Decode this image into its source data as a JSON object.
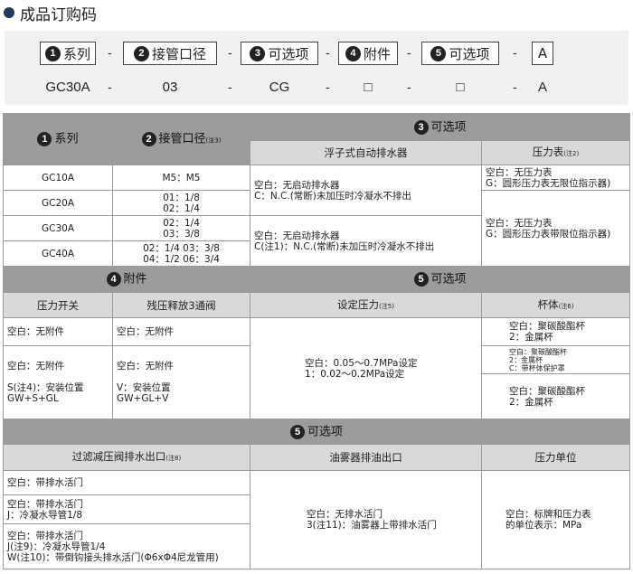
{
  "title": "成品订购码",
  "code": {
    "segments": [
      {
        "num": "1",
        "label": "系列"
      },
      {
        "num": "2",
        "label": "接管口径"
      },
      {
        "num": "3",
        "label": "可选项"
      },
      {
        "num": "4",
        "label": "附件"
      },
      {
        "num": "5",
        "label": "可选项"
      },
      {
        "label": "A"
      }
    ],
    "dash": "-",
    "values": [
      "GC30A",
      "03",
      "CG",
      "□",
      "□",
      "A"
    ]
  },
  "table1": {
    "col1": {
      "num": "1",
      "label": "系列"
    },
    "col2": {
      "num": "2",
      "label": "接管口径",
      "note": "(注3)"
    },
    "col3": {
      "num": "3",
      "label": "可选项"
    },
    "sub_float": "浮子式自动排水器",
    "sub_gauge": "压力表",
    "sub_gauge_note": "(注2)",
    "series": [
      "GC10A",
      "GC20A",
      "GC30A",
      "GC40A"
    ],
    "ports": [
      [
        "M5：M5"
      ],
      [
        "01：1/8",
        "02：1/4"
      ],
      [
        "02：1/4",
        "03：3/8"
      ],
      [
        "02：1/4  03：3/8",
        "04：1/2  06：3/4"
      ]
    ],
    "float_a": [
      "空白：无启动排水器",
      "C：N.C.(常断)未加压时冷凝水不排出"
    ],
    "float_b": [
      "空白：无启动排水器",
      "C(注1)：N.C.(常断)未加压时冷凝水不排出"
    ],
    "gauge_a": [
      "空白：无压力表",
      "G：圆形压力表无限位指示器)"
    ],
    "gauge_b": [
      "空白：无压力表",
      "G：圆形压力表带限位指示器)"
    ]
  },
  "table2": {
    "col4": {
      "num": "4",
      "label": "附件"
    },
    "col5": {
      "num": "5",
      "label": "可选项"
    },
    "sub_switch": "压力开关",
    "sub_valve": "残压释放3通阀",
    "sub_setp": "设定压力",
    "sub_setp_note": "(注5)",
    "sub_bowl": "杯体",
    "sub_bowl_note": "(注6)",
    "switch_a": "空白：无附件",
    "switch_b": [
      "空白：无附件",
      "",
      "S(注4)：安装位置",
      "GW+S+GL"
    ],
    "valve_a": "空白：无附件",
    "valve_b": [
      "空白：无附件",
      "",
      "V：安装位置",
      "GW+GL+V"
    ],
    "setp": [
      "空白：0.05～0.7MPa设定",
      "1：0.02～0.2MPa设定"
    ],
    "bowl_a": [
      "空白：聚碳酸酯杯",
      "2：金属杯"
    ],
    "bowl_b": [
      "空白：聚碳酸酯杯",
      "2：金属杯",
      "C：带杯体保护罩"
    ],
    "bowl_c": [
      "空白：聚碳酸酯杯",
      "2：金属杯"
    ]
  },
  "table3": {
    "col5": {
      "num": "5",
      "label": "可选项"
    },
    "sub_drain": "过滤减压阀排水出口",
    "sub_drain_note": "(注8)",
    "sub_mist": "油雾器排油出口",
    "sub_unit": "压力单位",
    "drain_a": "空白：带排水活门",
    "drain_b": [
      "空白：带排水活门",
      "J：冷凝水导管1/8"
    ],
    "drain_c": [
      "空白：带排水活门",
      "J(注9)：冷凝水导管1/4",
      "W(注10)：带倒钩接头排水活门(Φ6xΦ4尼龙管用)"
    ],
    "mist": [
      "空白：无排水活门",
      "3(注11)：油雾器上带排水活门"
    ],
    "unit": [
      "空白：标牌和压力表",
      "的单位表示：MPa"
    ]
  }
}
